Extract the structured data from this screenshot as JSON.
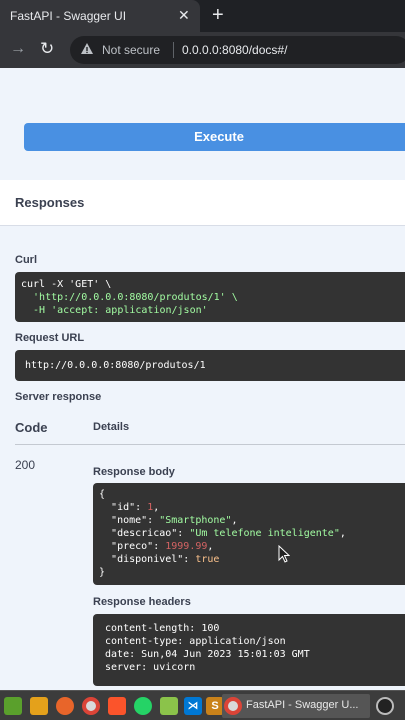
{
  "browser": {
    "tab_title": "FastAPI - Swagger UI",
    "tab_close": "✕",
    "new_tab": "+",
    "security_label": "Not secure",
    "url": "0.0.0.0:8080/docs#/"
  },
  "execute": {
    "label": "Execute"
  },
  "responses": {
    "title": "Responses",
    "curl_label": "Curl",
    "curl_lines": [
      "curl -X 'GET' \\",
      "  'http://0.0.0.0:8080/produtos/1' \\",
      "  -H 'accept: application/json'"
    ],
    "request_url_label": "Request URL",
    "request_url": "http://0.0.0.0:8080/produtos/1",
    "server_response_label": "Server response",
    "code_header": "Code",
    "details_header": "Details",
    "status_code": "200",
    "response_body_label": "Response body",
    "body": {
      "open": "{",
      "id_key": "\"id\"",
      "id_val": "1",
      "nome_key": "\"nome\"",
      "nome_val": "\"Smartphone\"",
      "descricao_key": "\"descricao\"",
      "descricao_val": "\"Um telefone inteligente\"",
      "preco_key": "\"preco\"",
      "preco_val": "1999.99",
      "disponivel_key": "\"disponivel\"",
      "disponivel_val": "true",
      "close": "}"
    },
    "response_headers_label": "Response headers",
    "headers": [
      " content-length: 100",
      " content-type: application/json",
      " date: Sun,04 Jun 2023 15:01:03 GMT",
      " server: uvicorn"
    ]
  },
  "taskbar": {
    "active_window_label": "FastAPI - Swagger U...",
    "icons": [
      "menu-icon",
      "folder-icon",
      "firefox-icon",
      "chrome-icon",
      "brave-icon",
      "whatsapp-icon",
      "files-icon",
      "vscode-icon",
      "sublime-icon",
      "chrome-icon",
      "obs-icon"
    ]
  },
  "colors": {
    "execute": "#4990e2",
    "code_bg": "#333333",
    "string": "#a2fca2",
    "number": "#d36363",
    "keyword": "#fcc28c",
    "panel_bg": "#eff4fb"
  }
}
